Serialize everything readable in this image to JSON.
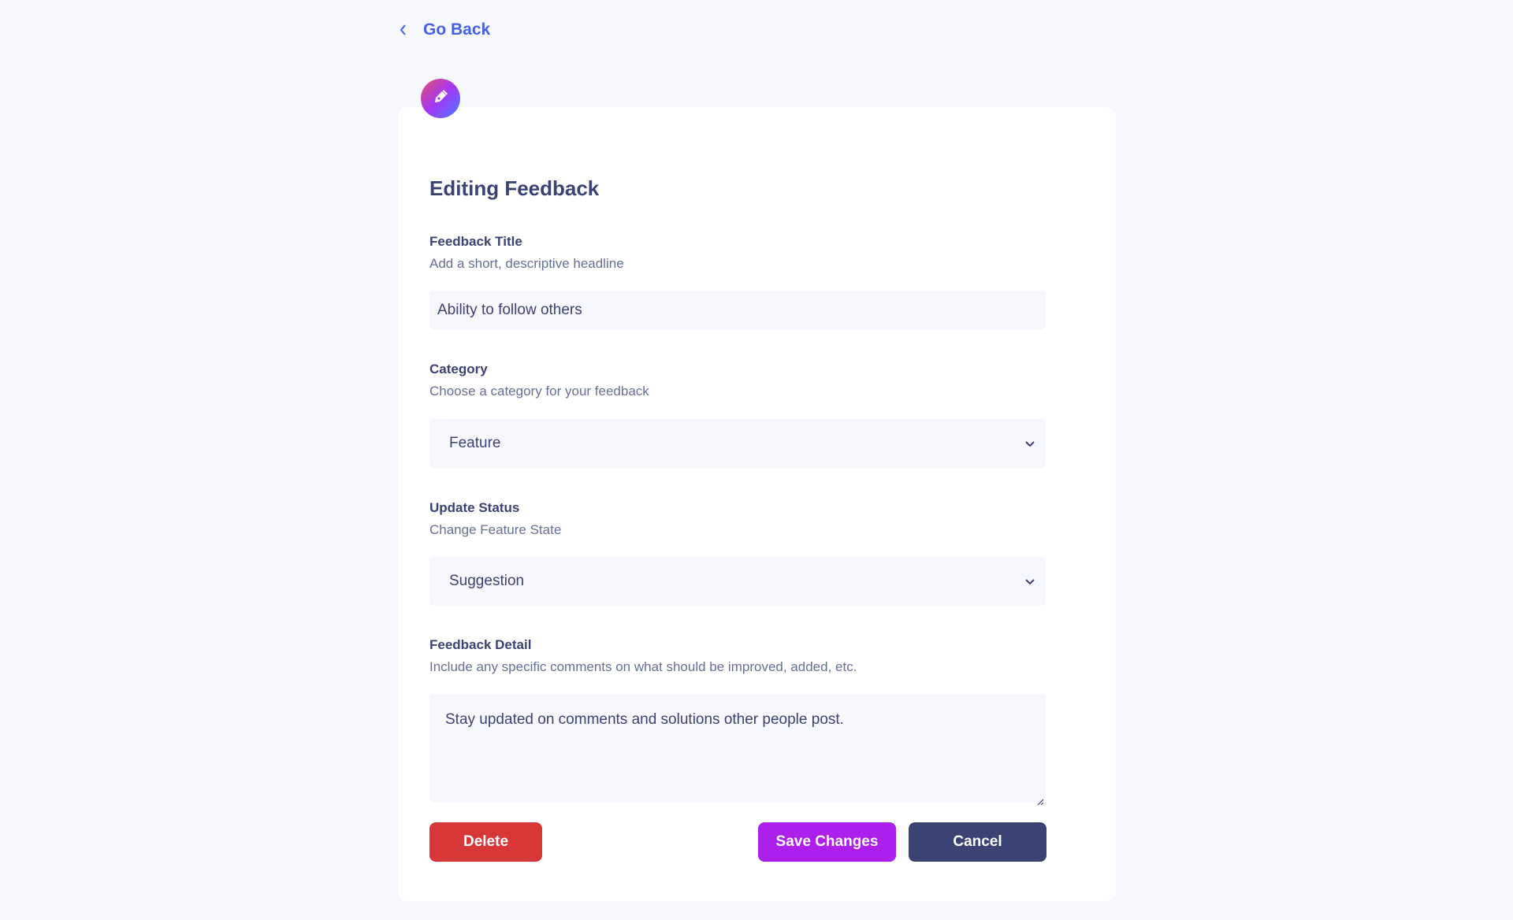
{
  "nav": {
    "back_label": "Go Back",
    "back_icon": "chevron-left-icon"
  },
  "badge": {
    "icon": "edit-pen-icon"
  },
  "form": {
    "title": "Editing Feedback",
    "fields": {
      "title": {
        "label": "Feedback Title",
        "hint": "Add a short, descriptive headline",
        "value": "Ability to follow others"
      },
      "category": {
        "label": "Category",
        "hint": "Choose a category for your feedback",
        "value": "Feature"
      },
      "status": {
        "label": "Update Status",
        "hint": "Change Feature State",
        "value": "Suggestion"
      },
      "detail": {
        "label": "Feedback Detail",
        "hint": "Include any specific comments on what should be improved, added, etc.",
        "value": "Stay updated on comments and solutions other people post."
      }
    },
    "buttons": {
      "delete": "Delete",
      "save": "Save Changes",
      "cancel": "Cancel"
    }
  },
  "colors": {
    "background": "#f7f8fd",
    "accent_blue": "#4661e6",
    "text_dark": "#3a4374",
    "text_muted": "#647196",
    "delete": "#d73737",
    "save": "#ad1fea",
    "cancel": "#3a4374"
  }
}
